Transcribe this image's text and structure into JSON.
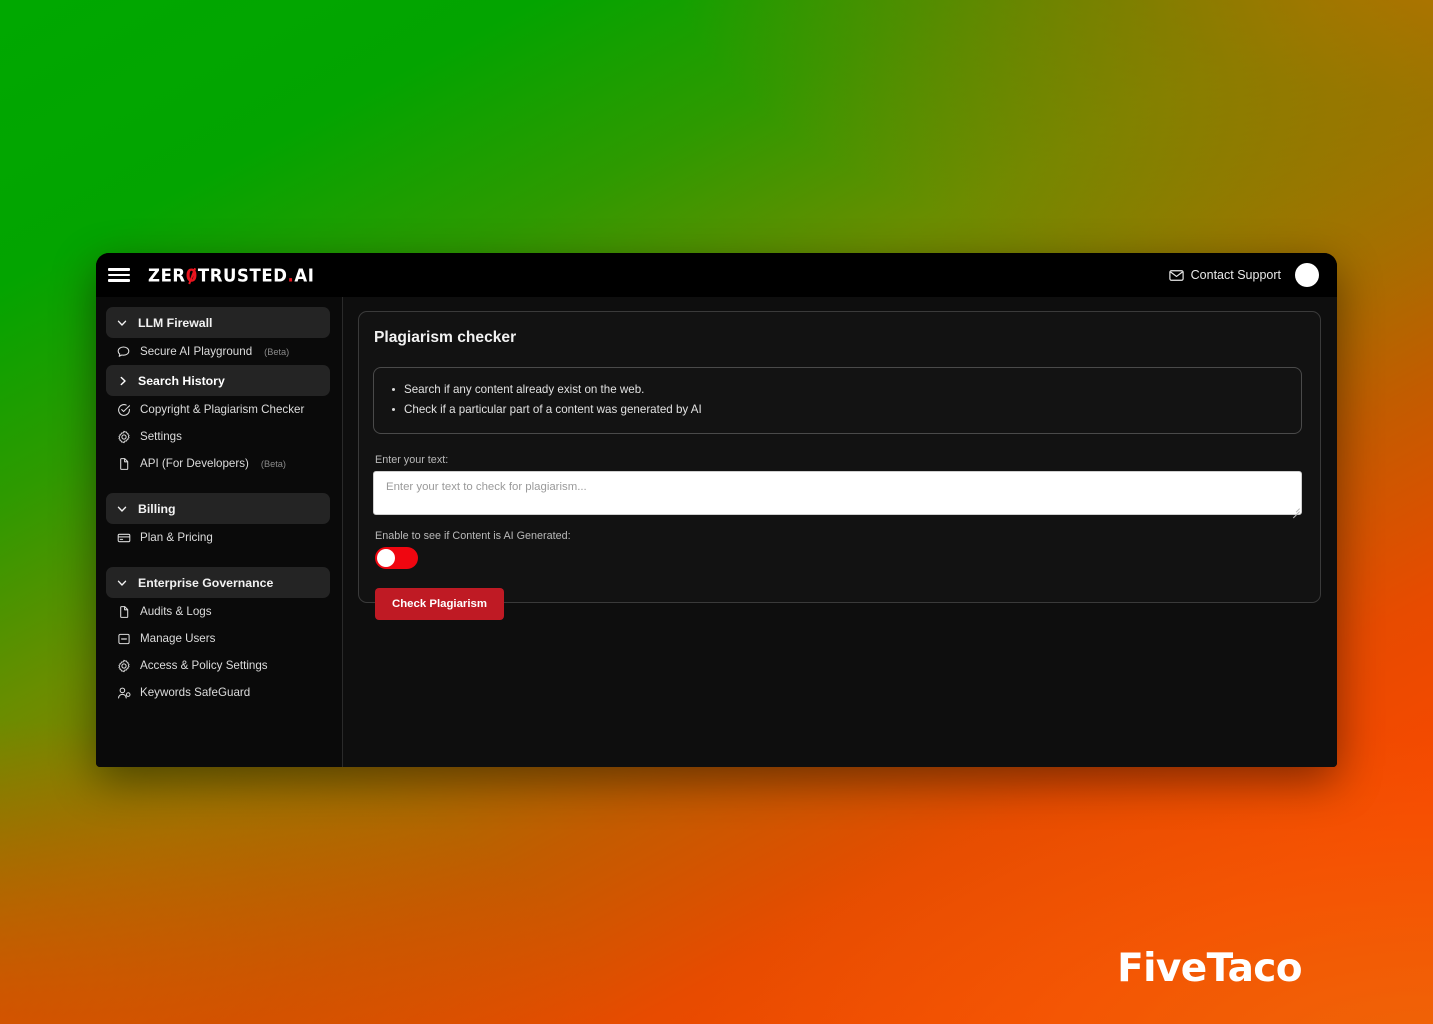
{
  "window": {
    "topbar": {
      "menu_icon": "hamburger-menu-icon",
      "brand_prefix": "ZER",
      "brand_zero": "0",
      "brand_middle": "TRUSTED",
      "brand_dot": ".",
      "brand_suffix": "AI",
      "contact_support_label": "Contact Support",
      "mail_icon": "mail-icon",
      "avatar_label": ""
    },
    "sidebar": {
      "groups": [
        {
          "header": {
            "label": "LLM Firewall",
            "icon": "chevron-down-icon",
            "expanded": true
          },
          "items": [
            {
              "label": "Secure AI Playground",
              "badge": "(Beta)",
              "icon": "chat-bubble-icon",
              "active": false
            },
            {
              "label": "Search History",
              "badge": "",
              "icon": "chevron-right-icon",
              "active": true
            },
            {
              "label": "Copyright & Plagiarism Checker",
              "badge": "",
              "icon": "check-circle-icon",
              "active": false
            },
            {
              "label": "Settings",
              "badge": "",
              "icon": "gear-icon",
              "active": false
            },
            {
              "label": "API (For Developers)",
              "badge": "(Beta)",
              "icon": "documents-icon",
              "active": false
            }
          ]
        },
        {
          "header": {
            "label": "Billing",
            "icon": "chevron-down-icon",
            "expanded": true
          },
          "items": [
            {
              "label": "Plan & Pricing",
              "badge": "",
              "icon": "credit-card-icon",
              "active": false
            }
          ]
        },
        {
          "header": {
            "label": "Enterprise Governance",
            "icon": "chevron-down-icon",
            "expanded": true
          },
          "items": [
            {
              "label": "Audits & Logs",
              "badge": "",
              "icon": "documents-icon",
              "active": false
            },
            {
              "label": "Manage Users",
              "badge": "",
              "icon": "id-card-icon",
              "active": false
            },
            {
              "label": "Access & Policy Settings",
              "badge": "",
              "icon": "gear-icon",
              "active": false
            },
            {
              "label": "Keywords SafeGuard",
              "badge": "",
              "icon": "user-add-icon",
              "active": false
            }
          ]
        }
      ]
    },
    "main": {
      "panel_title": "Plagiarism checker",
      "info_bullets": [
        "Search if any content already exist on the web.",
        "Check if a particular part of a content was generated by AI"
      ],
      "text_field": {
        "label": "Enter your text:",
        "placeholder": "Enter your text to check for plagiarism...",
        "value": ""
      },
      "ai_toggle": {
        "label": "Enable to see if Content is AI Generated:",
        "state": "off",
        "track_color": "#f00610",
        "knob_color": "#ffffff"
      },
      "submit_button": {
        "label": "Check Plagiarism",
        "color": "#bf1a24"
      }
    }
  },
  "watermark": {
    "text": "FiveTaco"
  },
  "theme": {
    "accent_red": "#e8141e",
    "button_red": "#bf1a24",
    "toggle_red": "#f00610",
    "window_bg": "#0b0b0b",
    "sidebar_bg": "#0a0a0a",
    "main_bg": "#0e0e0e",
    "bg_gradient_start": "#00a800",
    "bg_gradient_end": "#fa4a00"
  }
}
